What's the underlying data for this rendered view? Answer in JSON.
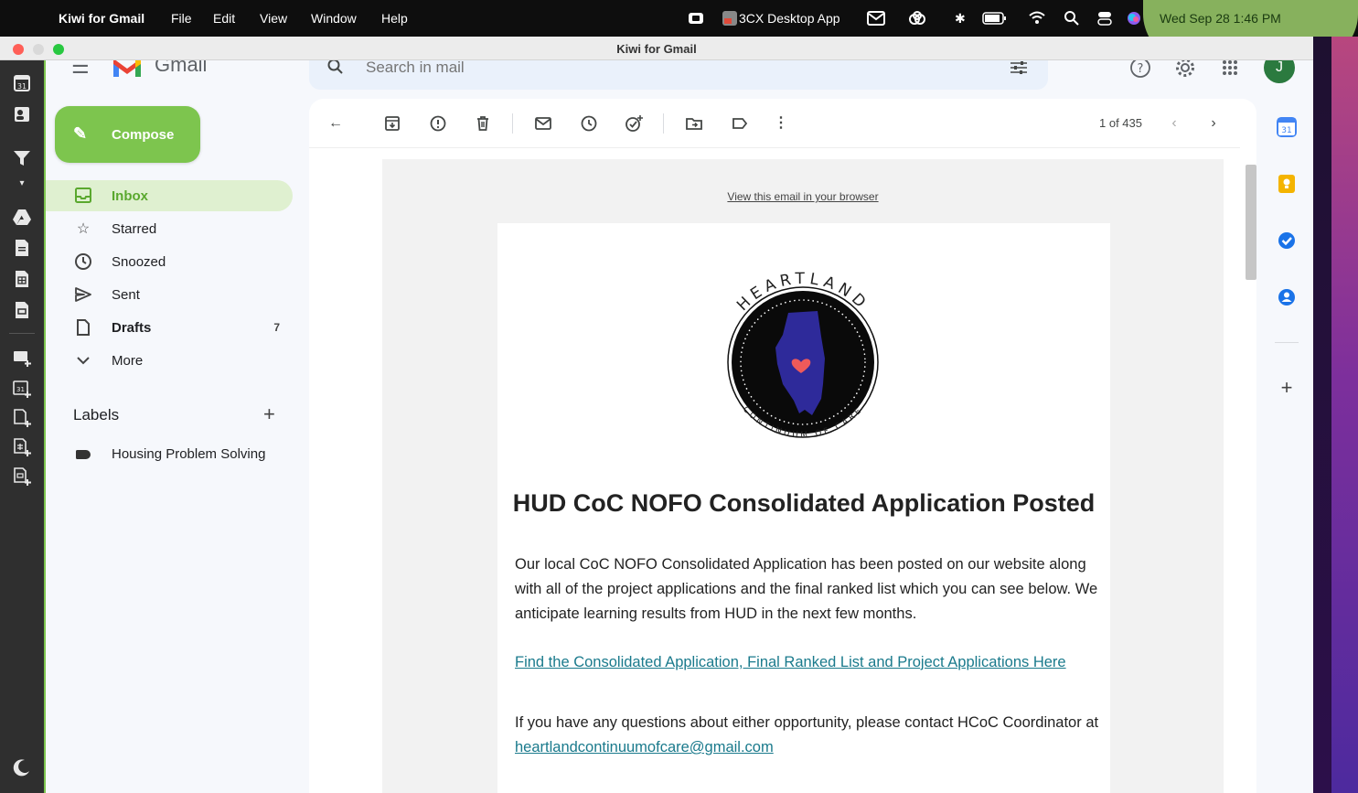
{
  "menubar": {
    "app_name": "Kiwi for Gmail",
    "menus": [
      "File",
      "Edit",
      "View",
      "Window",
      "Help"
    ],
    "status_app": "3CX Desktop App",
    "clock": "Wed Sep 28  1:46 PM"
  },
  "window": {
    "title": "Kiwi for Gmail"
  },
  "gmail": {
    "logo_text": "Gmail",
    "search_placeholder": "Search in mail",
    "avatar_initial": "J",
    "compose_label": "Compose",
    "nav": {
      "inbox": "Inbox",
      "starred": "Starred",
      "snoozed": "Snoozed",
      "sent": "Sent",
      "drafts": "Drafts",
      "drafts_count": "7",
      "more": "More"
    },
    "labels_header": "Labels",
    "labels": [
      "Housing Problem Solving"
    ],
    "pager": "1 of 435"
  },
  "email": {
    "view_in_browser": "View this email in your browser",
    "logo_top_text": "HEARTLAND",
    "logo_bottom_text": "CONTINUUM OF CARE",
    "title": "HUD CoC NOFO Consolidated Application Posted",
    "body": "Our local CoC NOFO Consolidated Application has been posted on our website along with all of the project applications and the final ranked list which you can see below. We anticipate learning results from HUD in the next few months.",
    "link_text": "Find the Consolidated Application, Final Ranked List and Project Applications Here",
    "contact_prefix": "If you have any questions about either opportunity, please contact HCoC Coordinator at ",
    "contact_email": "heartlandcontinuumofcare@gmail.com"
  },
  "colors": {
    "kiwi_green": "#7dc54e",
    "active_bg": "#dff0d0",
    "link": "#1a7a8c",
    "illinois": "#2e2a9a",
    "heart": "#ef5a5a"
  }
}
